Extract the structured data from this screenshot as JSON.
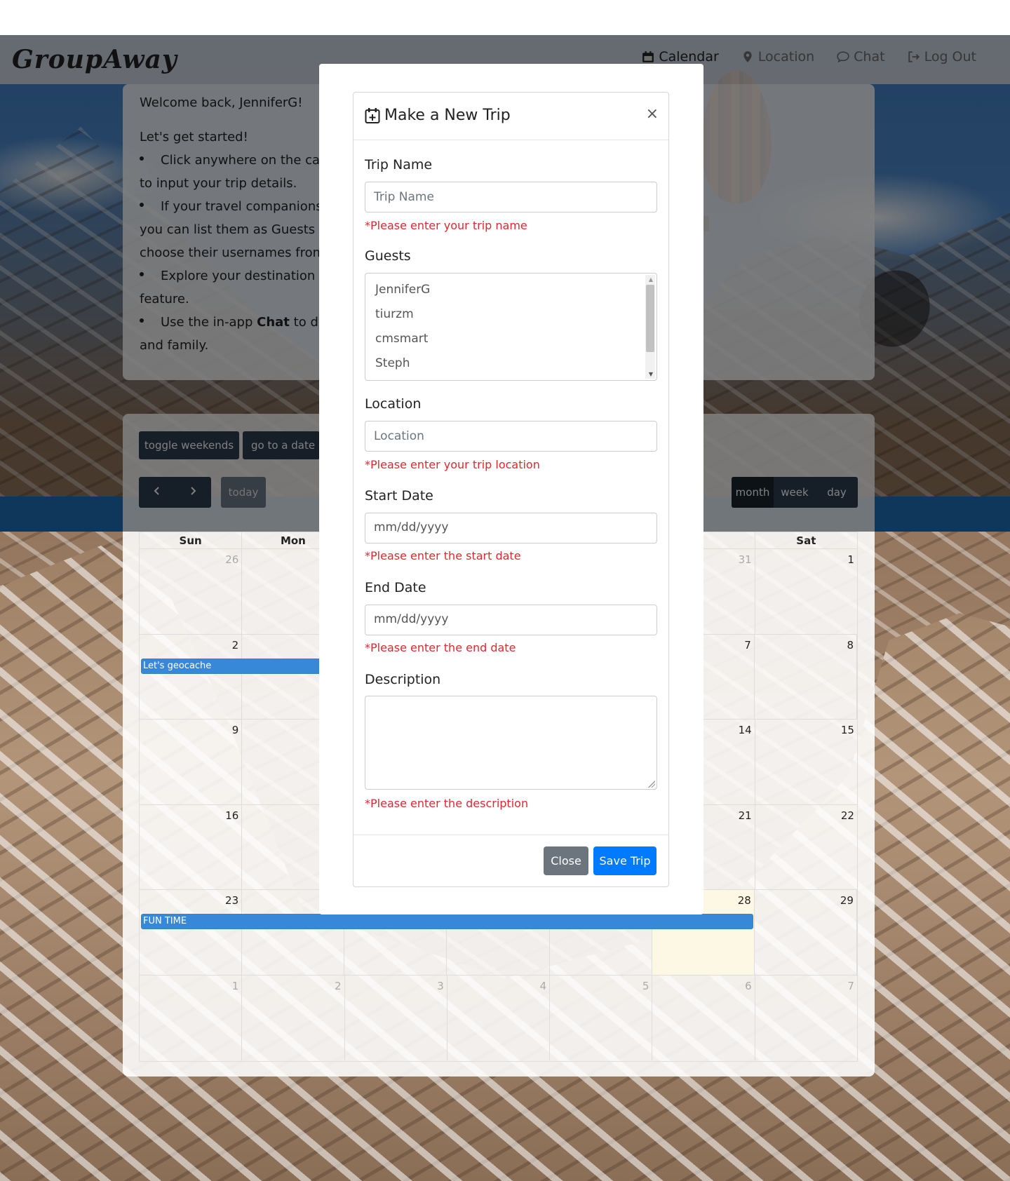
{
  "brand": "GroupAway",
  "nav": [
    {
      "label": "Calendar",
      "icon": "calendar-icon",
      "active": true
    },
    {
      "label": "Location",
      "icon": "map-marker-icon",
      "active": false
    },
    {
      "label": "Chat",
      "icon": "chat-icon",
      "active": false
    },
    {
      "label": "Log Out",
      "icon": "sign-out-icon",
      "active": false
    }
  ],
  "welcome": {
    "greeting": "Welcome back, JenniferG!",
    "intro": "Let's get started!",
    "lines": [
      "Click anywhere on the cal",
      "to input your trip details.",
      "If your travel companions",
      "you can list them as Guests",
      "choose their usernames from t",
      "Explore your destination",
      "feature.",
      "Use the in-app",
      "Chat",
      "to di",
      "and family."
    ]
  },
  "calendar": {
    "toggle_weekends": "toggle weekends",
    "go_to_date": "go to a date i",
    "today": "today",
    "views": [
      "month",
      "week",
      "day"
    ],
    "active_view": "month",
    "weekdays": [
      "Sun",
      "Mon",
      "",
      "",
      "",
      "ri",
      "Sat"
    ],
    "weeks": [
      [
        "26",
        "",
        "",
        "",
        "",
        "31",
        "1"
      ],
      [
        "2",
        "",
        "",
        "",
        "",
        "7",
        "8"
      ],
      [
        "9",
        "",
        "",
        "",
        "",
        "14",
        "15"
      ],
      [
        "16",
        "",
        "",
        "",
        "",
        "21",
        "22"
      ],
      [
        "23",
        "",
        "",
        "",
        "",
        "28",
        "29"
      ],
      [
        "1",
        "2",
        "3",
        "4",
        "5",
        "6",
        "7"
      ]
    ],
    "events": [
      {
        "title": "Let's geocache"
      },
      {
        "title": "FUN TIME"
      }
    ],
    "accent": "#3788d8"
  },
  "modal": {
    "title": "Make a New Trip",
    "close_symbol": "×",
    "trip_name_label": "Trip Name",
    "trip_name_placeholder": "Trip Name",
    "trip_name_error": "*Please enter your trip name",
    "guests_label": "Guests",
    "guests": [
      "JenniferG",
      "tiurzm",
      "cmsmart",
      "Steph"
    ],
    "location_label": "Location",
    "location_placeholder": "Location",
    "location_error": "*Please enter your trip location",
    "start_label": "Start Date",
    "start_value": "mm/dd/yyyy",
    "start_error": "*Please enter the start date",
    "end_label": "End Date",
    "end_value": "mm/dd/yyyy",
    "end_error": "*Please enter the end date",
    "description_label": "Description",
    "description_error": "*Please enter the description",
    "close_button": "Close",
    "save_button": "Save Trip",
    "error_color": "#e0282e",
    "primary_color": "#007bff"
  }
}
